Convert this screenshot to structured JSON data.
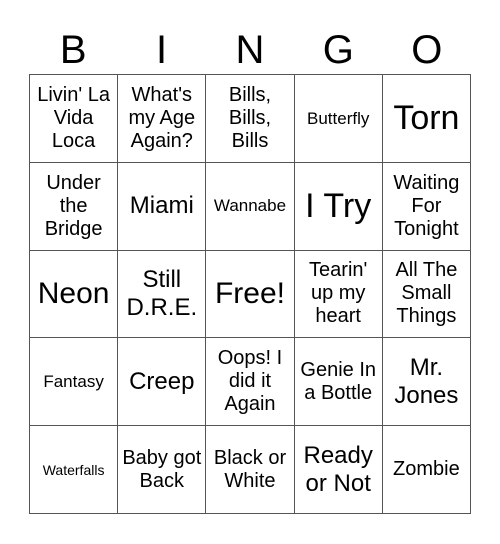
{
  "title_letters": [
    "B",
    "I",
    "N",
    "G",
    "O"
  ],
  "cells": [
    {
      "text": "Livin' La Vida Loca",
      "size": "md"
    },
    {
      "text": "What's my Age Again?",
      "size": "md"
    },
    {
      "text": "Bills, Bills, Bills",
      "size": "md"
    },
    {
      "text": "Butterfly",
      "size": "sm"
    },
    {
      "text": "Torn",
      "size": "xxl"
    },
    {
      "text": "Under the Bridge",
      "size": "md"
    },
    {
      "text": "Miami",
      "size": "lg"
    },
    {
      "text": "Wannabe",
      "size": "sm"
    },
    {
      "text": "I Try",
      "size": "xxl"
    },
    {
      "text": "Waiting For Tonight",
      "size": "md"
    },
    {
      "text": "Neon",
      "size": "xl"
    },
    {
      "text": "Still D.R.E.",
      "size": "lg"
    },
    {
      "text": "Free!",
      "size": "xl"
    },
    {
      "text": "Tearin' up my heart",
      "size": "md"
    },
    {
      "text": "All The Small Things",
      "size": "md"
    },
    {
      "text": "Fantasy",
      "size": "sm"
    },
    {
      "text": "Creep",
      "size": "lg"
    },
    {
      "text": "Oops! I did it Again",
      "size": "md"
    },
    {
      "text": "Genie In a Bottle",
      "size": "md"
    },
    {
      "text": "Mr. Jones",
      "size": "lg"
    },
    {
      "text": "Waterfalls",
      "size": "xs"
    },
    {
      "text": "Baby got Back",
      "size": "md"
    },
    {
      "text": "Black or White",
      "size": "md"
    },
    {
      "text": "Ready or Not",
      "size": "lg"
    },
    {
      "text": "Zombie",
      "size": "md"
    }
  ]
}
